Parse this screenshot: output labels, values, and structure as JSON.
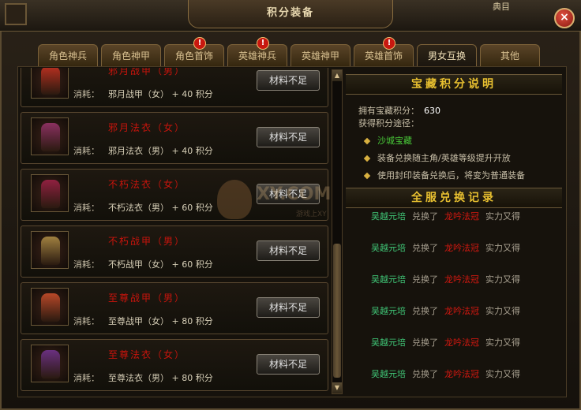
{
  "window": {
    "title": "积分装备",
    "top_right_text": "典目",
    "close_label": "×"
  },
  "tabs": [
    {
      "label": "角色神兵",
      "alert": false
    },
    {
      "label": "角色神甲",
      "alert": false
    },
    {
      "label": "角色首饰",
      "alert": true
    },
    {
      "label": "英雄神兵",
      "alert": true
    },
    {
      "label": "英雄神甲",
      "alert": false
    },
    {
      "label": "英雄首饰",
      "alert": true
    },
    {
      "label": "男女互换",
      "alert": false,
      "active": true
    },
    {
      "label": "其他",
      "alert": false
    }
  ],
  "alert_mark": "!",
  "items": [
    {
      "name": "邪月战甲（男）",
      "cost_label": "消耗：",
      "cost": "邪月战甲（女） + 40 积分",
      "button": "材料不足",
      "color": "#b83020"
    },
    {
      "name": "邪月法衣（女）",
      "cost_label": "消耗：",
      "cost": "邪月法衣（男） + 40 积分",
      "button": "材料不足",
      "color": "#8a3060"
    },
    {
      "name": "不朽法衣（女）",
      "cost_label": "消耗：",
      "cost": "不朽法衣（男） + 60 积分",
      "button": "材料不足",
      "color": "#902040"
    },
    {
      "name": "不朽战甲（男）",
      "cost_label": "消耗：",
      "cost": "不朽战甲（女） + 60 积分",
      "button": "材料不足",
      "color": "#a08040"
    },
    {
      "name": "至尊战甲（男）",
      "cost_label": "消耗：",
      "cost": "至尊战甲（女） + 80 积分",
      "button": "材料不足",
      "color": "#b84828"
    },
    {
      "name": "至尊法衣（女）",
      "cost_label": "消耗：",
      "cost": "至尊法衣（男） + 80 积分",
      "button": "材料不足",
      "color": "#6a3080"
    }
  ],
  "info": {
    "header": "宝藏积分说明",
    "points_label": "拥有宝藏积分：",
    "points_value": "630",
    "routes_label": "获得积分途径：",
    "routes": [
      {
        "text": "沙城宝藏",
        "highlight": true
      },
      {
        "text": "装备兑换随主角/英雄等级提升开放",
        "highlight": false
      },
      {
        "text": "使用封印装备兑换后，将变为普通装备",
        "highlight": false
      }
    ]
  },
  "records": {
    "header": "全服兑换记录",
    "rows": [
      {
        "who": "吴越元培",
        "act": "兑换了",
        "item": "龙吟法冠",
        "tail": "实力又得"
      },
      {
        "who": "吴越元培",
        "act": "兑换了",
        "item": "龙吟法冠",
        "tail": "实力又得"
      },
      {
        "who": "吴越元培",
        "act": "兑换了",
        "item": "龙吟法冠",
        "tail": "实力又得"
      },
      {
        "who": "吴越元培",
        "act": "兑换了",
        "item": "龙吟法冠",
        "tail": "实力又得"
      },
      {
        "who": "吴越元培",
        "act": "兑换了",
        "item": "龙吟法冠",
        "tail": "实力又得"
      },
      {
        "who": "吴越元培",
        "act": "兑换了",
        "item": "龙吟法冠",
        "tail": "实力又得"
      }
    ]
  },
  "scroll": {
    "up": "▲",
    "down": "▼"
  },
  "watermark": {
    "text": "XY.COM",
    "sub": "游戏上XY"
  }
}
